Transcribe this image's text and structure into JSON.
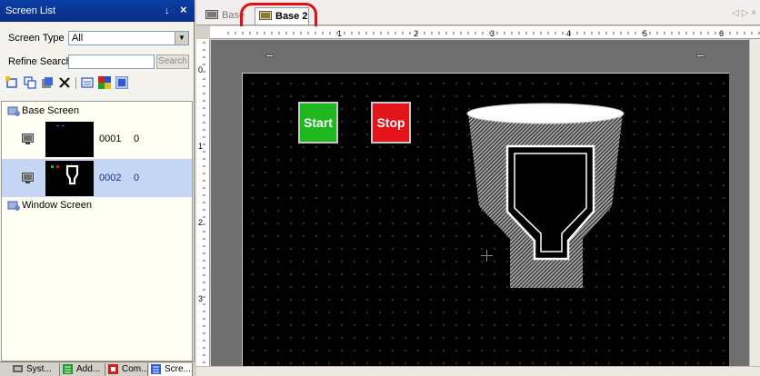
{
  "panel": {
    "title": "Screen List",
    "pin_glyph": "↓",
    "close_glyph": "×",
    "screen_type_label": "Screen Type",
    "screen_type_value": "All",
    "refine_label": "Refine Search",
    "refine_value": "",
    "search_label": "Search",
    "toolbar_icons": [
      "new-screen-icon",
      "copy-screen-icon",
      "paste-screen-icon",
      "delete-icon",
      "screen-properties-icon",
      "color-icon",
      "layer-icon"
    ],
    "groups": {
      "base": "Base Screen",
      "window": "Window Screen"
    },
    "screens": [
      {
        "number": "0001",
        "count": "0",
        "selected": false
      },
      {
        "number": "0002",
        "count": "0",
        "selected": true
      }
    ],
    "bottom_tabs": [
      {
        "label": "Syst...",
        "icon": "system-icon"
      },
      {
        "label": "Add...",
        "icon": "address-icon"
      },
      {
        "label": "Com...",
        "icon": "common-icon"
      },
      {
        "label": "Scre...",
        "icon": "screen-list-icon",
        "active": true
      }
    ]
  },
  "editor": {
    "tabs": [
      {
        "label": "Base",
        "active": false
      },
      {
        "label": "Base 2",
        "active": true
      }
    ],
    "tab_nav": "◁ ▷ ×",
    "ruler_h_labels": [
      "1",
      "2",
      "3",
      "4",
      "5",
      "6"
    ],
    "ruler_v_labels": [
      "0",
      "1",
      "2",
      "3"
    ],
    "canvas": {
      "start_label": "Start",
      "stop_label": "Stop",
      "start_color": "#1cb81e",
      "stop_color": "#e3141c"
    }
  },
  "colors": {
    "title_bar": "#0a3ea5",
    "highlight": "#e01010",
    "selection": "#c6d6f5"
  }
}
